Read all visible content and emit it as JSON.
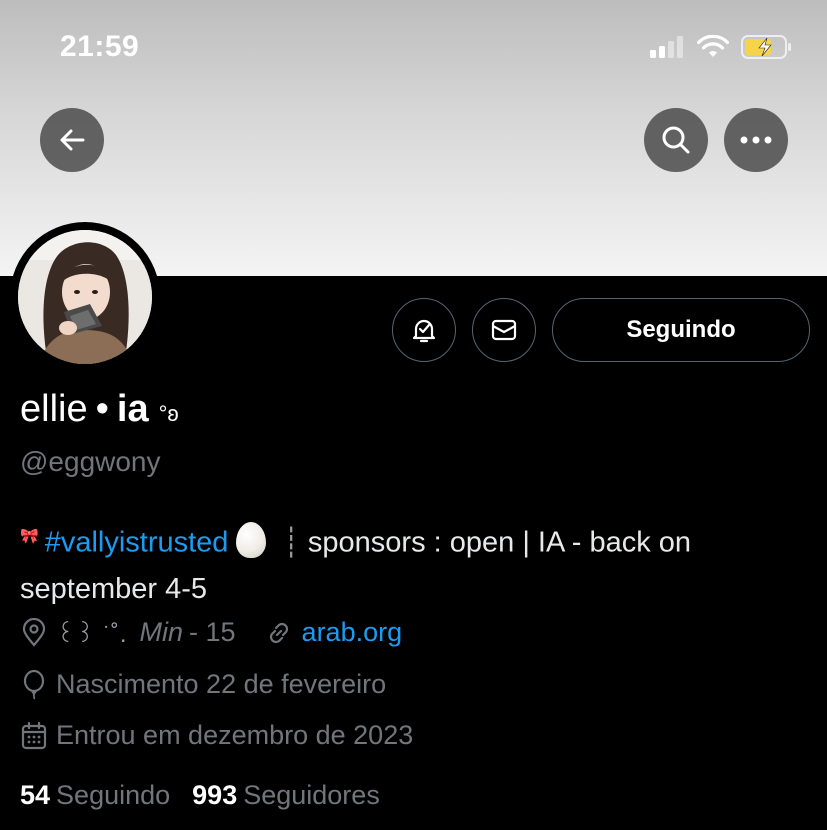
{
  "status_bar": {
    "time": "21:59"
  },
  "profile": {
    "name_part1": "ellie",
    "name_separator": "•",
    "name_part2": "ia",
    "name_decoration": "°ʚ",
    "handle": "@eggwony",
    "follow_label": "Seguindo"
  },
  "bio": {
    "ribbon": "🎀",
    "hashtag": "#vallyistrusted",
    "separator": "┊",
    "text": "sponsors : open | IA - back on september 4-5"
  },
  "meta": {
    "location_decoration": "꒰꒱ ͘ ˚.",
    "location_min": "Min",
    "location_rest": "- 15",
    "link": "arab.org",
    "birthday": "Nascimento 22 de fevereiro",
    "joined": "Entrou em dezembro de 2023"
  },
  "stats": {
    "following_count": "54",
    "following_label": "Seguindo",
    "followers_count": "993",
    "followers_label": "Seguidores"
  },
  "colors": {
    "accent": "#1d9bf0",
    "muted": "#71767b",
    "battery": "#f5d547"
  },
  "icons": [
    "back-arrow-icon",
    "search-icon",
    "more-icon",
    "notification-icon",
    "message-icon",
    "location-icon",
    "link-icon",
    "birthday-icon",
    "calendar-icon"
  ]
}
